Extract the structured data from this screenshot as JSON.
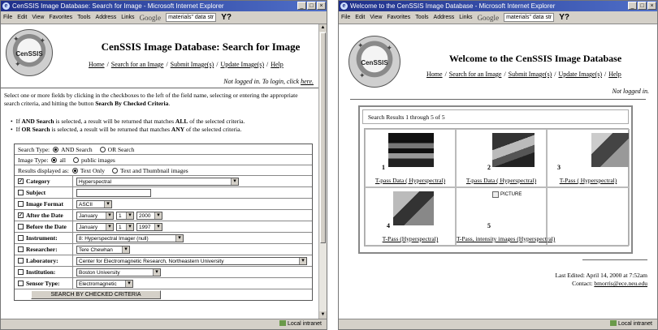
{
  "left_window": {
    "title": "CenSSIS Image Database: Search for Image - Microsoft Internet Explorer",
    "menu": [
      "File",
      "Edit",
      "View",
      "Favorites",
      "Tools",
      "Address",
      "Links"
    ],
    "google_label": "Google",
    "search_query": "materials\" data str",
    "logo_text": "CenSSIS",
    "page_title": "CenSSIS Image Database: Search for Image",
    "nav": [
      "Home",
      "Search for an Image",
      "Submit Image(s)",
      "Update Image(s)",
      "Help"
    ],
    "login_text": "Not logged in. To login, click",
    "login_link": "here.",
    "intro_a": "Select one or more fields by clicking in the checkboxes to the left of the field name, selecting or entering the appropriate search criteria, and hitting the button ",
    "intro_bold": "Search By Checked Criteria",
    "intro_b": ".",
    "bullet1_a": "If ",
    "bullet1_b": "AND Search",
    "bullet1_c": " is selected, a result will be returned that matches ",
    "bullet1_d": "ALL",
    "bullet1_e": " of the selected criteria.",
    "bullet2_a": "If ",
    "bullet2_b": "OR Search",
    "bullet2_c": " is selected, a result will be returned that matches ",
    "bullet2_d": "ANY",
    "bullet2_e": " of the selected criteria.",
    "search_type_label": "Search Type:",
    "search_type_and": "AND Search",
    "search_type_or": "OR Search",
    "image_type_label": "Image Type:",
    "image_type_all": "all",
    "image_type_public": "public images",
    "results_label": "Results displayed as:",
    "results_text": "Text Only",
    "results_thumb": "Text and Thumbnail images",
    "fields": {
      "category": {
        "label": "Category",
        "value": "Hyperspectral",
        "checked": true
      },
      "subject": {
        "label": "Subject",
        "value": "",
        "checked": false
      },
      "image_format": {
        "label": "Image Format",
        "value": "ASCII",
        "checked": false
      },
      "after_date": {
        "label": "After the Date",
        "month": "January",
        "day": "1",
        "year": "2000",
        "checked": true
      },
      "before_date": {
        "label": "Before the Date",
        "month": "January",
        "day": "1",
        "year": "1997",
        "checked": false
      },
      "instrument": {
        "label": "Instrument:",
        "value": "8: Hyperspectral Imager (null)",
        "checked": false
      },
      "researcher": {
        "label": "Researcher:",
        "value": "Tere Chewhan",
        "checked": false
      },
      "laboratory": {
        "label": "Laboratory:",
        "value": "Center for Electromagnetic Research, Northeastern University",
        "checked": false
      },
      "institution": {
        "label": "Institution:",
        "value": "Boston University",
        "checked": false
      },
      "sensor_type": {
        "label": "Sensor Type:",
        "value": "Electromagnetic",
        "checked": false
      }
    },
    "search_button": "SEARCH BY CHECKED CRITERIA",
    "status_zone": "Local intranet"
  },
  "right_window": {
    "title": "Welcome to the CenSSIS Image Database - Microsoft Internet Explorer",
    "menu": [
      "File",
      "Edit",
      "View",
      "Favorites",
      "Tools",
      "Address",
      "Links"
    ],
    "google_label": "Google",
    "search_query": "materials\" data str",
    "logo_text": "CenSSIS",
    "page_title": "Welcome to the CenSSIS Image Database",
    "nav": [
      "Home",
      "Search for an Image",
      "Submit Image(s)",
      "Update Image(s)",
      "Help"
    ],
    "login_text": "Not logged in.",
    "results_header": "Search Results 1 through 5 of 5",
    "results": [
      {
        "num": "1",
        "caption": "T-pass Data ( Hyperspectral)"
      },
      {
        "num": "2",
        "caption": "T-pass Data ( Hyperspectral)"
      },
      {
        "num": "3",
        "caption": "T-Pass ( Hyperspectral)"
      },
      {
        "num": "4",
        "caption": "T-Pass (Hyperspectral)"
      },
      {
        "num": "5",
        "caption": "T-Pass, intensity images (Hyperspectral)",
        "placeholder": "PICTURE"
      }
    ],
    "last_edited": "Last Edited: April 14, 2000 at 7:52am",
    "contact_label": "Contact:",
    "contact_email": "bmorris@ece.neu.edu",
    "status_zone": "Local intranet"
  }
}
